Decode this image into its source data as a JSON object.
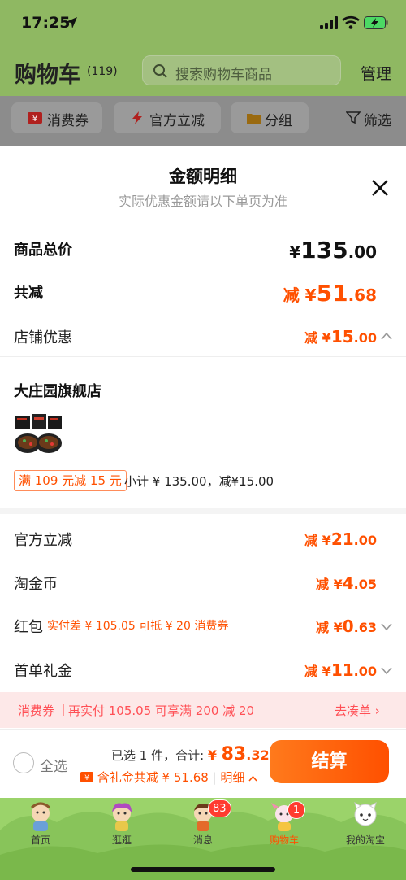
{
  "status_bar": {
    "time": "17:25"
  },
  "header": {
    "title": "购物车",
    "count": "(119)",
    "search_placeholder": "搜索购物车商品",
    "manage": "管理"
  },
  "filters": [
    {
      "label": "消费券",
      "icon": "coupon-icon"
    },
    {
      "label": "官方立减",
      "icon": "lightning-icon"
    },
    {
      "label": "分组",
      "icon": "folder-icon"
    },
    {
      "label": "筛选",
      "icon": "filter-icon"
    }
  ],
  "sheet": {
    "title": "金额明细",
    "subtitle": "实际优惠金额请以下单页为准",
    "total": {
      "label": "商品总价",
      "currency": "¥",
      "int": "135",
      "dec": ".00"
    },
    "discount_total": {
      "label": "共减",
      "prefix": "减 ¥",
      "int": "51",
      "dec": ".68"
    },
    "store_discount": {
      "label": "店铺优惠",
      "prefix": "减 ¥",
      "int": "15",
      "dec": ".00"
    },
    "store": {
      "name": "大庄园旗舰店",
      "promo": "满 109 元减 15 元",
      "subtotal": "小计 ¥ 135.00，减¥15.00"
    },
    "official": {
      "label": "官方立减",
      "prefix": "减 ¥",
      "int": "21",
      "dec": ".00"
    },
    "taojinbi": {
      "label": "淘金币",
      "prefix": "减 ¥",
      "int": "4",
      "dec": ".05"
    },
    "hongbao": {
      "label": "红包",
      "note": "实付差 ¥ 105.05 可抵 ¥ 20 消费券",
      "prefix": "减 ¥",
      "int": "0",
      "dec": ".63"
    },
    "first_gift": {
      "label": "首单礼金",
      "prefix": "减 ¥",
      "int": "11",
      "dec": ".00"
    }
  },
  "coupon_bar": {
    "tag": "消费券",
    "text": "再实付 105.05 可享满 200 减 20",
    "action": "去凑单 ›"
  },
  "footer": {
    "select_all": "全选",
    "selected": "已选 1 件，合计: ",
    "currency": "¥ ",
    "int": "83",
    "dec": ".32",
    "gift": "含礼金共减 ¥ 51.68",
    "detail": "明细",
    "checkout": "结算"
  },
  "tabs": [
    {
      "label": "首页"
    },
    {
      "label": "逛逛"
    },
    {
      "label": "消息",
      "badge": "83"
    },
    {
      "label": "购物车",
      "badge": "1"
    },
    {
      "label": "我的淘宝"
    }
  ]
}
